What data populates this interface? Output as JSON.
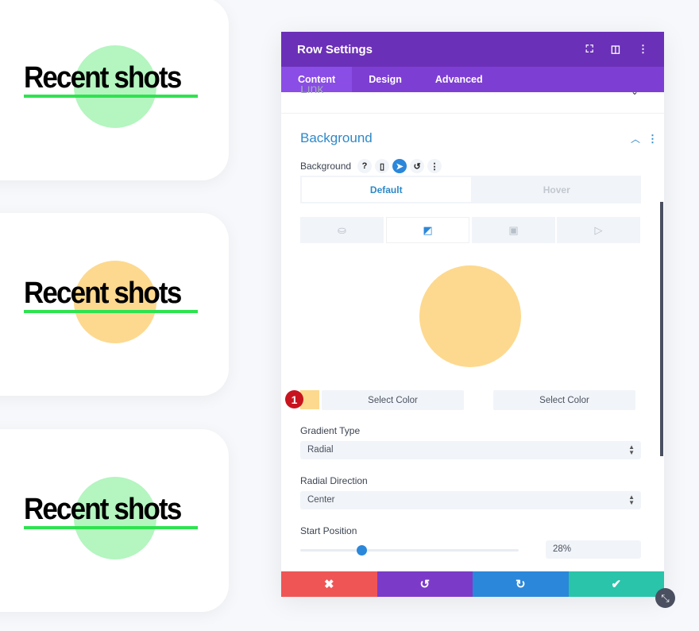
{
  "cards": [
    {
      "text": "Recent shots",
      "circle_color": "#b4f5c0"
    },
    {
      "text": "Recent shots",
      "circle_color": "#fdd98f"
    },
    {
      "text": "Recent shots",
      "circle_color": "#b4f5c0"
    }
  ],
  "panel": {
    "title": "Row Settings",
    "tabs": [
      "Content",
      "Design",
      "Advanced"
    ],
    "active_tab": "Content",
    "collapsed_section": "Link",
    "section_title": "Background",
    "bg_label": "Background",
    "state_tabs": [
      "Default",
      "Hover"
    ],
    "preview_color": "#fdd98f",
    "badge": "1",
    "select_color_1": "Select Color",
    "select_color_2": "Select Color",
    "gradient_type_label": "Gradient Type",
    "gradient_type": "Radial",
    "radial_direction_label": "Radial Direction",
    "radial_direction": "Center",
    "start_position_label": "Start Position",
    "start_position": "28%",
    "start_position_value": 28
  },
  "colors": {
    "header": "#6b30b8",
    "accent": "#2b87da",
    "cancel": "#ef5555",
    "undo": "#7b3bc8",
    "redo": "#2b87da",
    "save": "#29c4a9"
  }
}
